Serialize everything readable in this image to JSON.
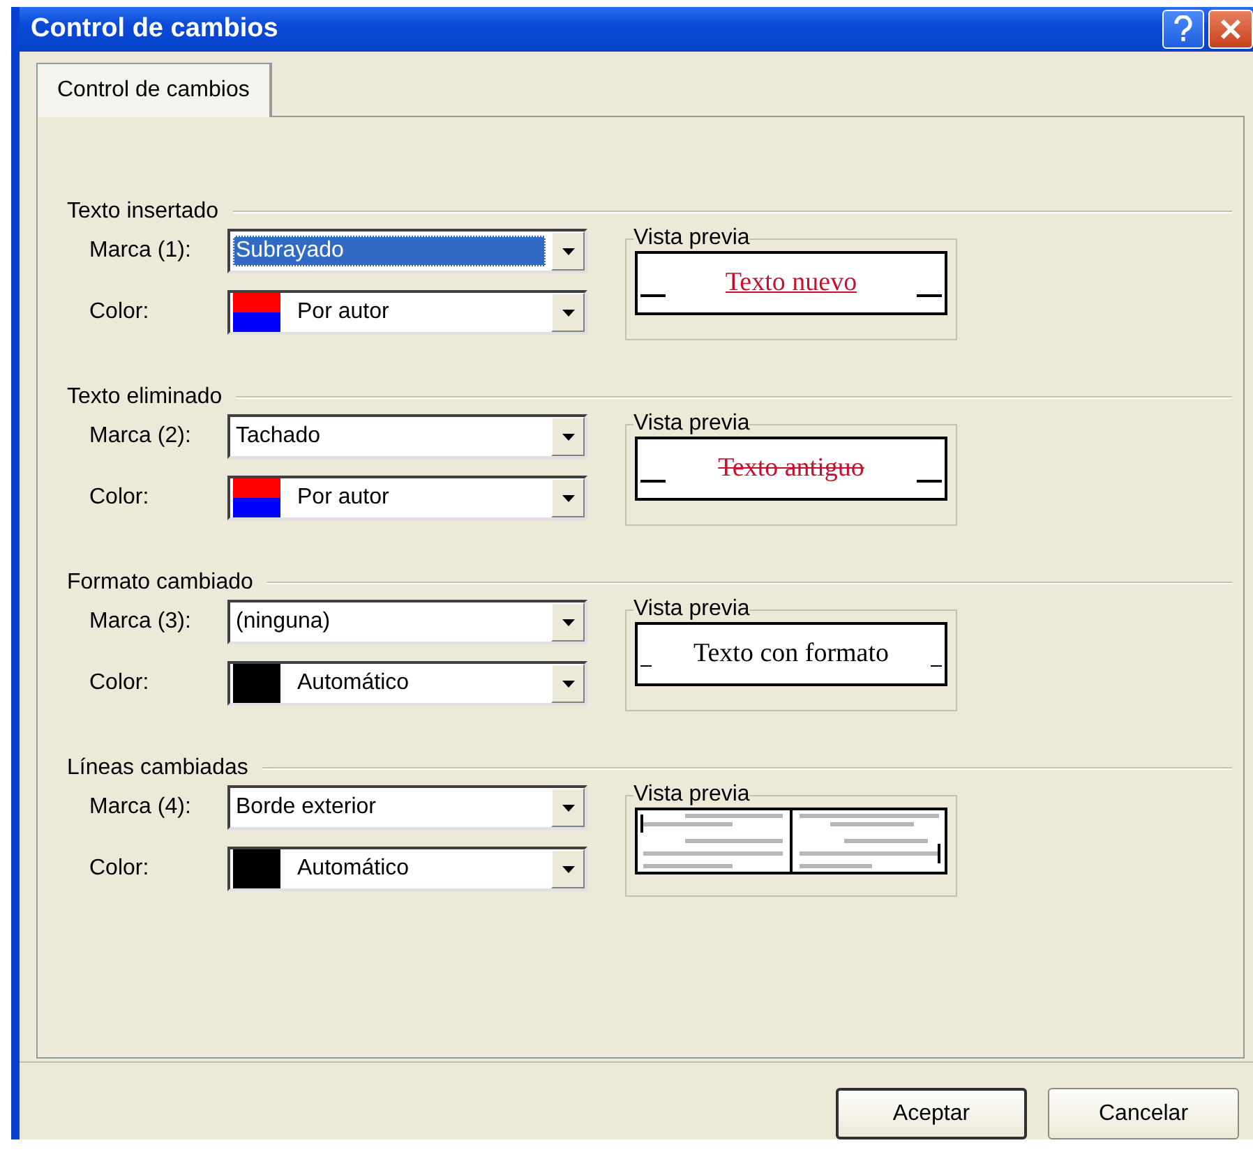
{
  "window": {
    "title": "Control de cambios"
  },
  "tabs": [
    {
      "label": "Control de cambios",
      "selected": true
    }
  ],
  "sections": [
    {
      "title": "Texto insertado",
      "mark_label": "Marca (1):",
      "mark_value": "Subrayado",
      "mark_focused": true,
      "color_label": "Color:",
      "color_value": "Por autor",
      "swatch": {
        "kind": "split"
      },
      "preview_label": "Vista previa",
      "preview": {
        "kind": "underline",
        "text": "Texto nuevo",
        "color": "#c8102e"
      }
    },
    {
      "title": "Texto eliminado",
      "mark_label": "Marca (2):",
      "mark_value": "Tachado",
      "mark_focused": false,
      "color_label": "Color:",
      "color_value": "Por autor",
      "swatch": {
        "kind": "split"
      },
      "preview_label": "Vista previa",
      "preview": {
        "kind": "strike",
        "text": "Texto antiguo",
        "color": "#c8102e"
      }
    },
    {
      "title": "Formato cambiado",
      "mark_label": "Marca (3):",
      "mark_value": "(ninguna)",
      "mark_focused": false,
      "color_label": "Color:",
      "color_value": "Automático",
      "swatch": {
        "kind": "solid"
      },
      "preview_label": "Vista previa",
      "preview": {
        "kind": "plain",
        "text": "Texto con formato",
        "color": "#000000"
      }
    },
    {
      "title": "Líneas cambiadas",
      "mark_label": "Marca (4):",
      "mark_value": "Borde exterior",
      "mark_focused": false,
      "color_label": "Color:",
      "color_value": "Automático",
      "swatch": {
        "kind": "solid"
      },
      "preview_label": "Vista previa",
      "preview": {
        "kind": "lines"
      }
    }
  ],
  "buttons": [
    {
      "label": "Aceptar",
      "default": true
    },
    {
      "label": "Cancelar",
      "default": false
    }
  ]
}
